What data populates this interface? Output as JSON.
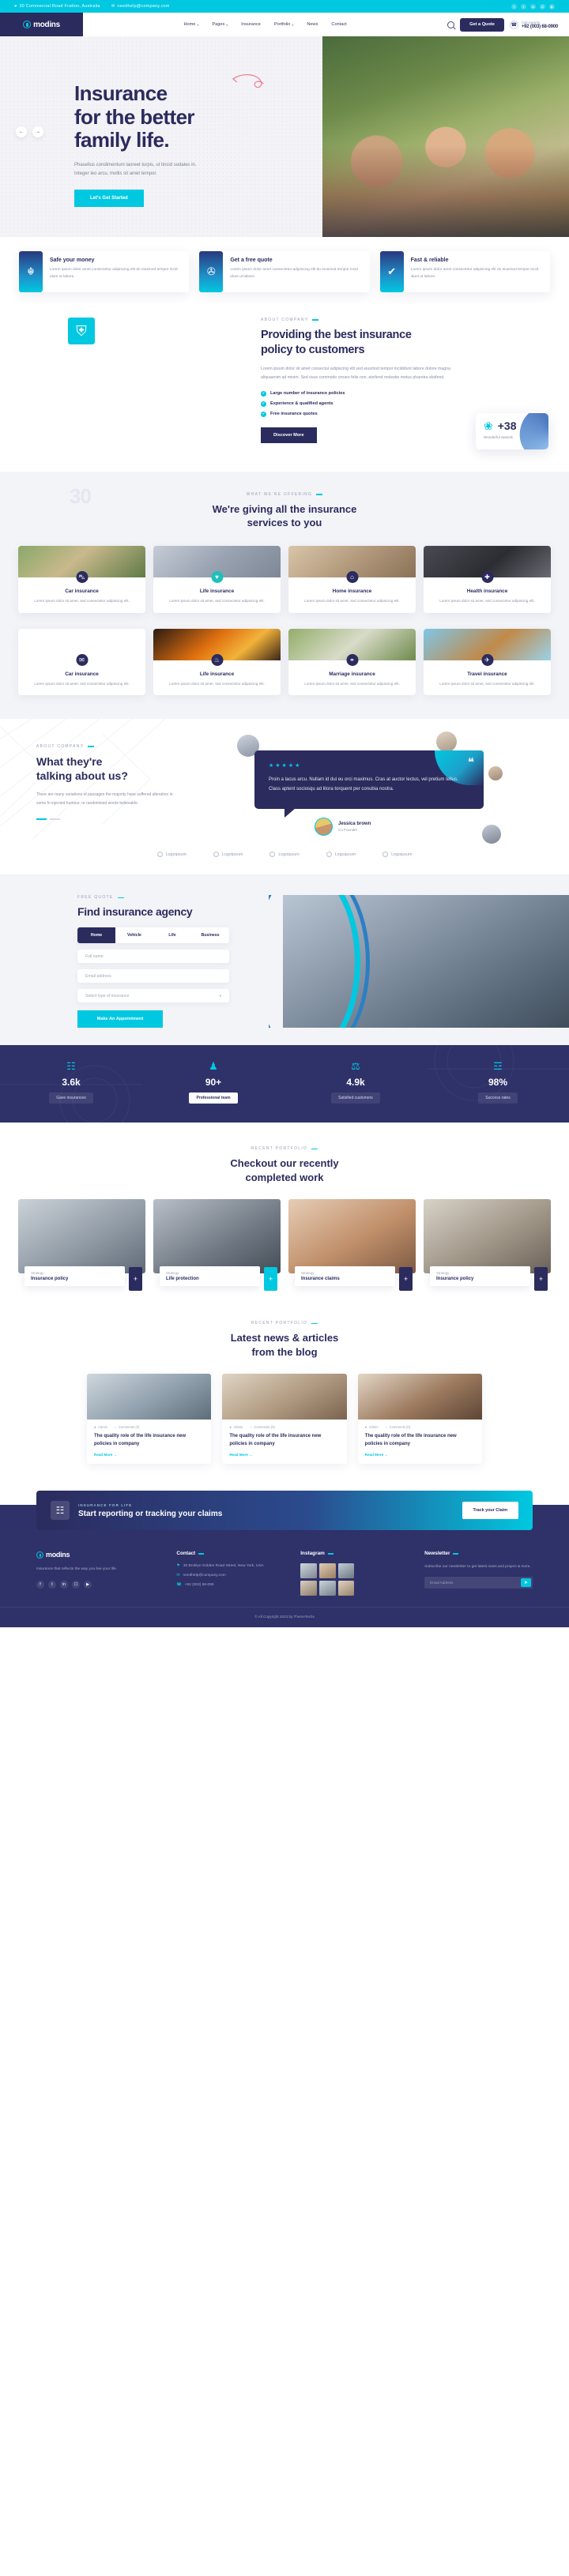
{
  "topbar": {
    "address": "30 Commercial Road Fratton, Australia",
    "email": "needhelp@company.com",
    "address_icon": "location-pin-icon",
    "email_icon": "envelope-icon",
    "socials": [
      "f",
      "t",
      "in",
      "ig",
      "yt"
    ]
  },
  "nav": {
    "logo": "modins",
    "items": [
      {
        "label": "Home",
        "caret": "▾"
      },
      {
        "label": "Pages",
        "caret": "▾"
      },
      {
        "label": "Insurance",
        "caret": ""
      },
      {
        "label": "Portfolio",
        "caret": "▾"
      },
      {
        "label": "News",
        "caret": ""
      },
      {
        "label": "Contact",
        "caret": ""
      }
    ],
    "search_icon": "search-icon",
    "quote_button": "Get a Quote",
    "phone_icon": "phone-ring-icon",
    "call_label": "Call experts",
    "call_number": "+92 (003) 68-0900"
  },
  "hero": {
    "title_line1": "Insurance",
    "title_line2": "for the better",
    "title_line3": "family life.",
    "paragraph": "Phasellus condimentum laoreet turpis, ut tincid sodales in. Integer leo arcu, mollis sit amet tempor.",
    "button": "Let's Get Started",
    "prev_arrow": "←",
    "next_arrow": "→"
  },
  "features": [
    {
      "icon": "hand-holding-money-icon",
      "glyph": "☬",
      "title": "Safe your money",
      "desc": "Lorem ipsum dolor amet consectetur adipiscing elit do eiusmod tempor incid idunt ut labore."
    },
    {
      "icon": "mobile-quote-icon",
      "glyph": "✇",
      "title": "Get a free quote",
      "desc": "Lorem ipsum dolor amet consectetur adipiscing elit do eiusmod tempor incid idunt ut labore."
    },
    {
      "icon": "award-badge-icon",
      "glyph": "✔",
      "title": "Fast & reliable",
      "desc": "Lorem ipsum dolor amet consectetur adipiscing elit do eiusmod tempor incid idunt ut labore."
    }
  ],
  "about": {
    "shield_icon": "shield-icon",
    "shield_glyph": "⛨",
    "eyebrow": "ABOUT COMPANY",
    "heading_line1": "Providing the best insurance",
    "heading_line2": "policy to customers",
    "paragraph": "Lorem ipsum dolor sit amet consectur adipiscing elit sed eiusmod tempor incididunt labore dolore magna aliquaenim ad minim. Sed risus commodo ornare felis non. eleifend molestie metus pharetra eleifend.",
    "list": [
      "Large number of insurance policies",
      "Experience & qualified agents",
      "Free insurance quotes"
    ],
    "button": "Discover More",
    "award_icon": "award-ribbon-icon",
    "award_glyph": "❀",
    "award_number": "+38",
    "award_label": "Wonderful awards"
  },
  "services": {
    "ghost_number": "30",
    "eyebrow": "WHAT WE'RE OFFERING",
    "heading_line1": "We're giving all the insurance",
    "heading_line2": "services to you",
    "cards": [
      {
        "title": "Car insurance",
        "desc": "Lorem ipsum dolor sit amet, sed consectetur adipiscing elit.",
        "icon": "car-icon",
        "glyph": "⛍",
        "accent": "navy"
      },
      {
        "title": "Life insurance",
        "desc": "Lorem ipsum dolor sit amet, sed consectetur adipiscing elit.",
        "icon": "heartbeat-icon",
        "glyph": "♥",
        "accent": "teal"
      },
      {
        "title": "Home insurance",
        "desc": "Lorem ipsum dolor sit amet, sed consectetur adipiscing elit.",
        "icon": "house-icon",
        "glyph": "⌂",
        "accent": "navy"
      },
      {
        "title": "Health insurance",
        "desc": "Lorem ipsum dolor sit amet, sed consectetur adipiscing elit.",
        "icon": "medical-cross-icon",
        "glyph": "✚",
        "accent": "navy"
      },
      {
        "title": "Car insurance",
        "desc": "Lorem ipsum dolor sit amet, sed consectetur adipiscing elit.",
        "icon": "briefcase-icon",
        "glyph": "✉",
        "accent": "navy"
      },
      {
        "title": "Life insurance",
        "desc": "Lorem ipsum dolor sit amet, sed consectetur adipiscing elit.",
        "icon": "fire-icon",
        "glyph": "♨",
        "accent": "navy"
      },
      {
        "title": "Marriage insurance",
        "desc": "Lorem ipsum dolor sit amet, sed consectetur adipiscing elit.",
        "icon": "rings-icon",
        "glyph": "⚭",
        "accent": "navy"
      },
      {
        "title": "Travel insurance",
        "desc": "Lorem ipsum dolor sit amet, sed consectetur adipiscing elit.",
        "icon": "airplane-icon",
        "glyph": "✈",
        "accent": "navy"
      }
    ]
  },
  "testimonial": {
    "eyebrow": "ABOUT COMPANY",
    "heading_line1": "What they're",
    "heading_line2": "talking about us?",
    "paragraph": "There are many variations of passages the majority have suffered alteration in some fo injected humour, or randomised words believable.",
    "stars": "★★★★★",
    "quote": "Proin a lacus arcu. Nullam id dui eu orci maximus. Cras at auctor lectus, vel pretium tellus. Class aptent sociosqu ad litora torquent per conubia nostra.",
    "quote_mark": "❝",
    "author_name": "Jessica brown",
    "author_role": "Co Founder"
  },
  "logos": [
    {
      "label": "Logoipsum"
    },
    {
      "label": "Logoipsum"
    },
    {
      "label": "Logoipsum"
    },
    {
      "label": "Logoipsum"
    },
    {
      "label": "Logoipsum"
    }
  ],
  "quote_form": {
    "eyebrow": "FREE QUOTE",
    "heading": "Find insurance agency",
    "tabs": [
      {
        "label": "Home",
        "active": true
      },
      {
        "label": "Vehicle",
        "active": false
      },
      {
        "label": "Life",
        "active": false
      },
      {
        "label": "Business",
        "active": false
      }
    ],
    "fields": [
      {
        "placeholder": "Full name",
        "name": "full-name-input",
        "chev": ""
      },
      {
        "placeholder": "Email address",
        "name": "email-input",
        "chev": ""
      },
      {
        "placeholder": "Select type of insurance",
        "name": "insurance-type-select",
        "chev": "▾"
      }
    ],
    "button": "Make An Appointment"
  },
  "stats": [
    {
      "icon": "policy-doc-icon",
      "glyph": "☷",
      "number": "3.6k",
      "label": "Gave insurances",
      "highlight": false
    },
    {
      "icon": "team-icon",
      "glyph": "♟",
      "number": "90+",
      "label": "Professional team",
      "highlight": true
    },
    {
      "icon": "scales-icon",
      "glyph": "⚖",
      "number": "4.9k",
      "label": "Satisfied customers",
      "highlight": false
    },
    {
      "icon": "growth-icon",
      "glyph": "☲",
      "number": "98%",
      "label": "Success rates",
      "highlight": false
    }
  ],
  "portfolio": {
    "eyebrow": "RECENT PORTFOLIO",
    "heading_line1": "Checkout our recently",
    "heading_line2": "completed work",
    "items": [
      {
        "category": "Strategy",
        "title": "Insurance policy",
        "plus": "+",
        "accent": "navy"
      },
      {
        "category": "Strategy",
        "title": "Life protection",
        "plus": "+",
        "accent": "teal"
      },
      {
        "category": "Strategy",
        "title": "Insurance claims",
        "plus": "+",
        "accent": "navy"
      },
      {
        "category": "Strategy",
        "title": "Insurance policy",
        "plus": "+",
        "accent": "navy"
      }
    ]
  },
  "blog": {
    "eyebrow": "RECENT PORTFOLIO",
    "heading_line1": "Latest news & articles",
    "heading_line2": "from the blog",
    "posts": [
      {
        "author_icon": "user-icon",
        "author": "Admin",
        "comment_icon": "comment-icon",
        "comments": "Comments (0)",
        "title": "The quality role of the life insurance new policies in company",
        "read_more": "Read More →"
      },
      {
        "author_icon": "user-icon",
        "author": "Admin",
        "comment_icon": "comment-icon",
        "comments": "Comments (0)",
        "title": "The quality role of the life insurance new policies in company",
        "read_more": "Read More →"
      },
      {
        "author_icon": "user-icon",
        "author": "Admin",
        "comment_icon": "comment-icon",
        "comments": "Comments (0)",
        "title": "The quality role of the life insurance new policies in company",
        "read_more": "Read More →"
      }
    ]
  },
  "cta": {
    "icon": "clipboard-claim-icon",
    "glyph": "☷",
    "eyebrow": "INSURANCE FOR LIFE",
    "title": "Start reporting or tracking your claims",
    "button": "Track your Claim"
  },
  "footer": {
    "logo": "modins",
    "description": "Insurance that reflects the way you live your life.",
    "socials": [
      "f",
      "t",
      "in",
      "ig",
      "yt"
    ],
    "contact_heading": "Contact",
    "contact_items": [
      {
        "icon": "location-pin-icon",
        "glyph": "⚑",
        "text": "30 Broklyn Golden Road Street, New York, USA"
      },
      {
        "icon": "envelope-icon",
        "glyph": "✉",
        "text": "needhelp@company.com"
      },
      {
        "icon": "phone-icon",
        "glyph": "☎",
        "text": "+92 (003) 68-090"
      }
    ],
    "instagram_heading": "Instagram",
    "newsletter_heading": "Newsletter",
    "newsletter_text": "Subscribe our newsletter to get latest news and project & more.",
    "newsletter_placeholder": "Email Address",
    "newsletter_send_icon": "send-icon",
    "newsletter_send_glyph": "➤"
  },
  "copyright": "© All Copyright 2023 by ThemeTechs",
  "colors": {
    "primary": "#2b2b5e",
    "accent": "#00c8e0",
    "teal": "#1fc0bb",
    "footer_bg": "#2f3169"
  }
}
